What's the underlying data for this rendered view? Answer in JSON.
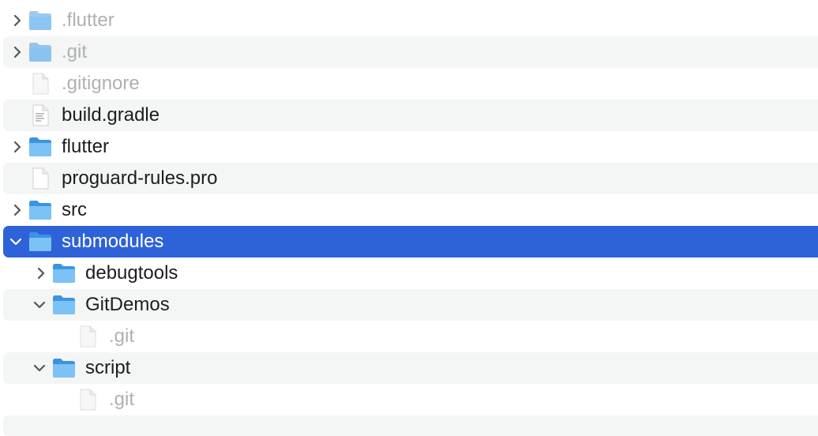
{
  "file_tree": {
    "items": [
      {
        "label": ".flutter",
        "type": "folder",
        "expanded": false,
        "dimmed": true,
        "icon": "folder-icon"
      },
      {
        "label": ".git",
        "type": "folder",
        "expanded": false,
        "dimmed": true,
        "icon": "folder-icon"
      },
      {
        "label": ".gitignore",
        "type": "file",
        "dimmed": true,
        "icon": "file-icon"
      },
      {
        "label": "build.gradle",
        "type": "file",
        "dimmed": false,
        "icon": "text-file-icon"
      },
      {
        "label": "flutter",
        "type": "folder",
        "expanded": false,
        "dimmed": false,
        "icon": "folder-icon"
      },
      {
        "label": "proguard-rules.pro",
        "type": "file",
        "dimmed": false,
        "icon": "file-icon"
      },
      {
        "label": "src",
        "type": "folder",
        "expanded": false,
        "dimmed": false,
        "icon": "folder-icon"
      },
      {
        "label": "submodules",
        "type": "folder",
        "expanded": true,
        "selected": true,
        "dimmed": false,
        "icon": "folder-icon"
      },
      {
        "label": "debugtools",
        "type": "folder",
        "expanded": false,
        "dimmed": false,
        "icon": "folder-icon"
      },
      {
        "label": "GitDemos",
        "type": "folder",
        "expanded": true,
        "dimmed": false,
        "icon": "folder-icon"
      },
      {
        "label": ".git",
        "type": "file",
        "dimmed": true,
        "icon": "file-icon"
      },
      {
        "label": "script",
        "type": "folder",
        "expanded": true,
        "dimmed": false,
        "icon": "folder-icon"
      },
      {
        "label": ".git",
        "type": "file",
        "dimmed": true,
        "icon": "file-icon"
      }
    ]
  },
  "colors": {
    "selection": "#2e62d9",
    "stripe": "#f4f5f5",
    "text": "#1d1d1f",
    "dimmed_text": "#b0b0b0",
    "folder_blue": "#5aaef2"
  }
}
